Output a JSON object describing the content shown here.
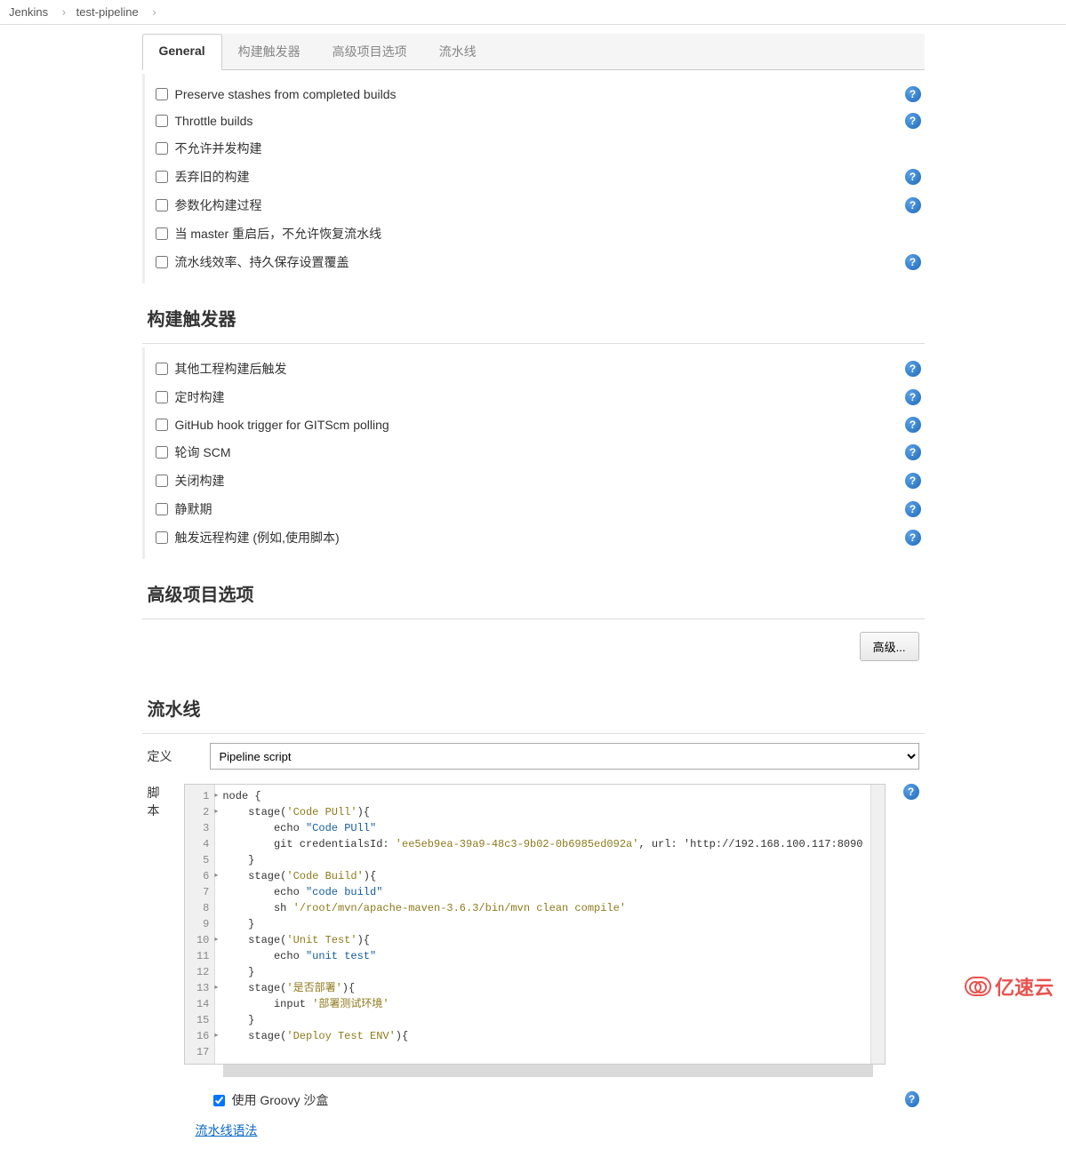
{
  "breadcrumb": {
    "root": "Jenkins",
    "item": "test-pipeline"
  },
  "tabs": [
    {
      "label": "General",
      "active": true
    },
    {
      "label": "构建触发器",
      "active": false
    },
    {
      "label": "高级项目选项",
      "active": false
    },
    {
      "label": "流水线",
      "active": false
    }
  ],
  "general": {
    "options": [
      {
        "label": "Preserve stashes from completed builds",
        "help": true
      },
      {
        "label": "Throttle builds",
        "help": true
      },
      {
        "label": "不允许并发构建",
        "help": false
      },
      {
        "label": "丢弃旧的构建",
        "help": true
      },
      {
        "label": "参数化构建过程",
        "help": true
      },
      {
        "label": "当 master 重启后，不允许恢复流水线",
        "help": false
      },
      {
        "label": "流水线效率、持久保存设置覆盖",
        "help": true
      }
    ]
  },
  "triggers": {
    "title": "构建触发器",
    "options": [
      {
        "label": "其他工程构建后触发",
        "help": true
      },
      {
        "label": "定时构建",
        "help": true
      },
      {
        "label": "GitHub hook trigger for GITScm polling",
        "help": true
      },
      {
        "label": "轮询 SCM",
        "help": true
      },
      {
        "label": "关闭构建",
        "help": true
      },
      {
        "label": "静默期",
        "help": true
      },
      {
        "label": "触发远程构建 (例如,使用脚本)",
        "help": true
      }
    ]
  },
  "advanced": {
    "title": "高级项目选项",
    "button": "高级..."
  },
  "pipeline": {
    "title": "流水线",
    "definition_label": "定义",
    "definition_value": "Pipeline script",
    "script_label": "脚本",
    "code": {
      "lines": [
        "node {",
        "    stage('Code PUll'){",
        "        echo \"Code PUll\"",
        "        git credentialsId: 'ee5eb9ea-39a9-48c3-9b02-0b6985ed092a', url: 'http://192.168.100.117:8090",
        "    }",
        "    stage('Code Build'){",
        "        echo \"code build\"",
        "        sh '/root/mvn/apache-maven-3.6.3/bin/mvn clean compile'",
        "    }",
        "    stage('Unit Test'){",
        "        echo \"unit test\"",
        "    }",
        "    stage('是否部署'){",
        "        input '部署测试环境'",
        "    }",
        "    stage('Deploy Test ENV'){",
        ""
      ],
      "fold_lines": [
        1,
        2,
        6,
        10,
        13,
        16
      ]
    },
    "sandbox_label": "使用 Groovy 沙盒",
    "sandbox_checked": true,
    "syntax_link": "流水线语法"
  },
  "watermark": "亿速云"
}
